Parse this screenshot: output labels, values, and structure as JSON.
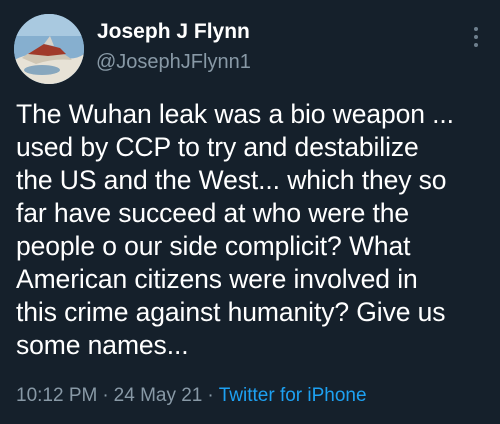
{
  "tweet": {
    "display_name": "Joseph J Flynn",
    "handle": "@JosephJFlynn1",
    "text": "The Wuhan leak was a bio weapon ...\nused by CCP to try and destabilize\nthe US and the West... which they so\nfar have succeed at who were the\npeople o our side complicit?  What\nAmerican citizens were involved in\nthis crime against humanity? Give us\nsome names...",
    "time": "10:12 PM",
    "separator": "·",
    "date": "24 May 21",
    "source": "Twitter for iPhone"
  },
  "icons": {
    "more": "more-vertical-icon",
    "avatar": "profile-photo"
  },
  "colors": {
    "background": "#15202b",
    "primary_text": "#ffffff",
    "secondary_text": "#8899a6",
    "link": "#1da1f2"
  }
}
